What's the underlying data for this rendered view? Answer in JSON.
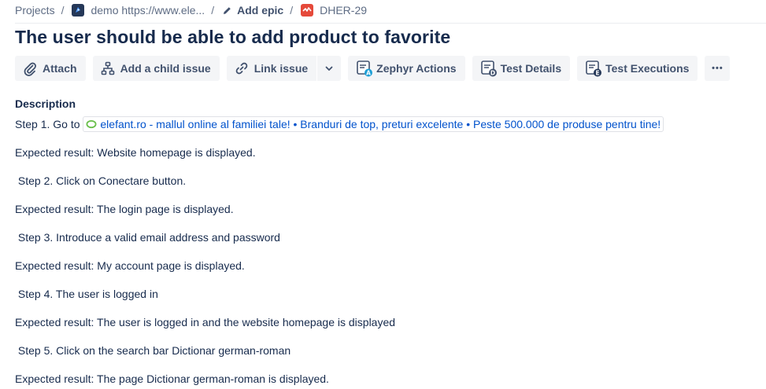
{
  "breadcrumb": {
    "projects": "Projects",
    "separator": "/",
    "project": "demo https://www.ele...",
    "add_epic": "Add epic",
    "issue_key": "DHER-29"
  },
  "title": "The user should be able to add product to favorite",
  "toolbar": {
    "attach": "Attach",
    "add_child": "Add a child issue",
    "link_issue": "Link issue",
    "zephyr": "Zephyr Actions",
    "test_details": "Test Details",
    "test_executions": "Test Executions",
    "more": "•••"
  },
  "description": {
    "heading": "Description",
    "step1_prefix": "Step 1. Go to ",
    "step1_link": "elefant.ro - mallul online al familiei tale! • Branduri de top, preturi excelente • Peste 500.000 de produse pentru tine!",
    "lines": [
      "Expected result: Website homepage is displayed.",
      " Step 2. Click on Conectare button.",
      "Expected result: The login page is displayed.",
      " Step 3. Introduce a valid email address and password",
      "Expected result: My account page is displayed.",
      " Step 4. The user is logged in",
      "Expected result: The user is logged in and the website homepage is displayed",
      " Step 5. Click on the search bar Dictionar german-roman",
      "Expected result: The page Dictionar german-roman is displayed."
    ]
  },
  "colors": {
    "text": "#172b4d",
    "muted": "#5e6c84",
    "button_bg": "#f4f5f7",
    "link": "#0052cc",
    "issue_icon": "#e5493a",
    "zephyr_badge": "#1e9fd6"
  },
  "icons": {
    "project": "rocket-icon",
    "add_epic": "pencil-icon",
    "issue": "bug-icon",
    "attach": "paperclip-icon",
    "add_child": "hierarchy-icon",
    "link_issue": "link-icon",
    "split_caret": "chevron-down-icon",
    "zephyr": "zephyr-actions-icon",
    "test_details": "test-details-icon",
    "test_executions": "test-executions-icon",
    "more": "more-icon",
    "link_favicon": "elefant-favicon-icon"
  }
}
